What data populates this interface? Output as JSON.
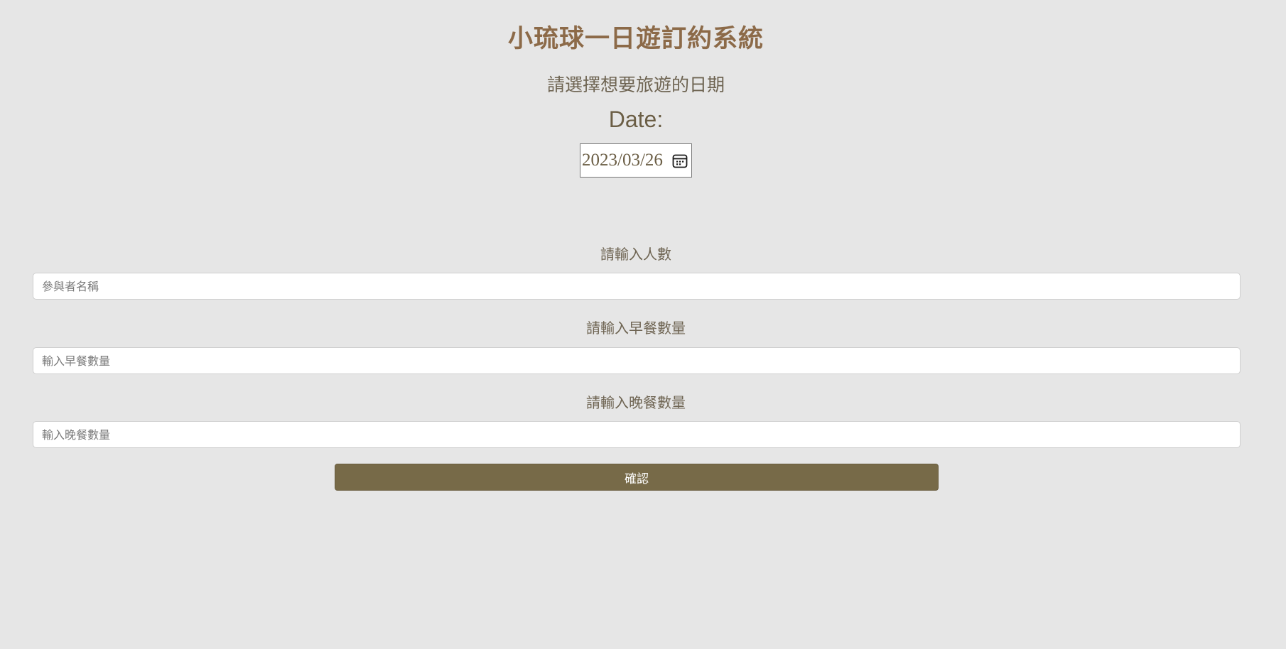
{
  "page": {
    "title": "小琉球一日遊訂約系統",
    "date_prompt": "請選擇想要旅遊的日期",
    "date_label": "Date:"
  },
  "date_picker": {
    "value": "2023/03/26",
    "icon": "calendar-icon"
  },
  "form": {
    "people_label": "請輸入人數",
    "people_placeholder": "參與者名稱",
    "breakfast_label": "請輸入早餐數量",
    "breakfast_placeholder": "輸入早餐數量",
    "dinner_label": "請輸入晚餐數量",
    "dinner_placeholder": "輸入晚餐數量",
    "confirm_label": "確認"
  },
  "colors": {
    "background": "#e6e6e6",
    "title": "#8c6a48",
    "text": "#6b5e45",
    "button": "#776a48"
  }
}
